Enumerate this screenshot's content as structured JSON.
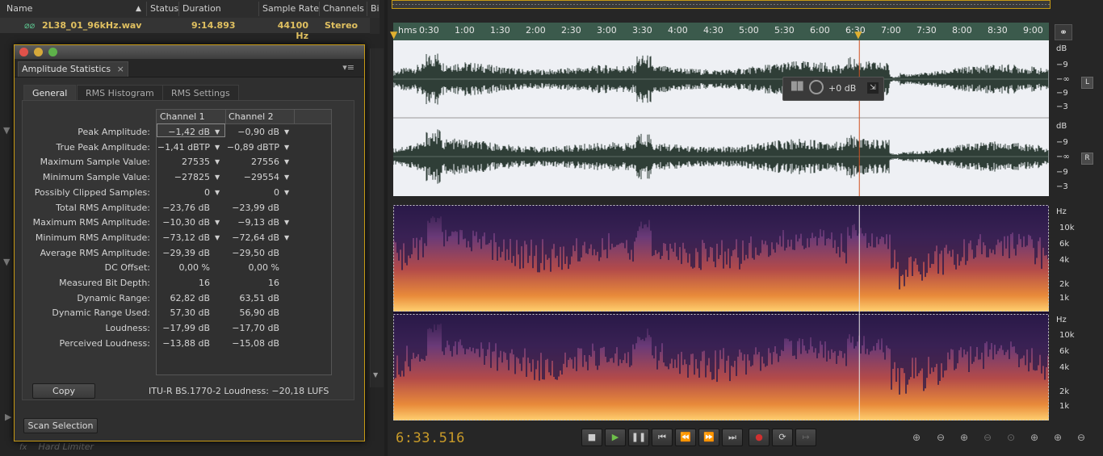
{
  "files": {
    "columns": [
      "Name",
      "Status",
      "Duration",
      "Sample Rate",
      "Channels",
      "Bi"
    ],
    "row": {
      "name": "2L38_01_96kHz.wav",
      "duration": "9:14.893",
      "sample_rate": "44100 Hz",
      "channels": "Stereo"
    },
    "ghost_text": "Hard Limiter"
  },
  "dialog": {
    "title": "Amplitude Statistics",
    "tabs": [
      "General",
      "RMS Histogram",
      "RMS Settings"
    ],
    "active_tab": "General",
    "columns": [
      "Channel 1",
      "Channel 2"
    ],
    "rows": [
      {
        "label": "Peak Amplitude:",
        "ch1": "−1,42 dB",
        "ch2": "−0,90 dB",
        "pin": true
      },
      {
        "label": "True Peak Amplitude:",
        "ch1": "−1,41 dBTP",
        "ch2": "−0,89 dBTP",
        "pin": true
      },
      {
        "label": "Maximum Sample Value:",
        "ch1": "27535",
        "ch2": "27556",
        "pin": true
      },
      {
        "label": "Minimum Sample Value:",
        "ch1": "−27825",
        "ch2": "−29554",
        "pin": true
      },
      {
        "label": "Possibly Clipped Samples:",
        "ch1": "0",
        "ch2": "0",
        "pin": true
      },
      {
        "label": "Total RMS Amplitude:",
        "ch1": "−23,76 dB",
        "ch2": "−23,99 dB",
        "pin": false
      },
      {
        "label": "Maximum RMS Amplitude:",
        "ch1": "−10,30 dB",
        "ch2": "−9,13 dB",
        "pin": true
      },
      {
        "label": "Minimum RMS Amplitude:",
        "ch1": "−73,12 dB",
        "ch2": "−72,64 dB",
        "pin": true
      },
      {
        "label": "Average RMS Amplitude:",
        "ch1": "−29,39 dB",
        "ch2": "−29,50 dB",
        "pin": false
      },
      {
        "label": "DC Offset:",
        "ch1": "0,00 %",
        "ch2": "0,00 %",
        "pin": false
      },
      {
        "label": "Measured Bit Depth:",
        "ch1": "16",
        "ch2": "16",
        "pin": false
      },
      {
        "label": "Dynamic Range:",
        "ch1": "62,82 dB",
        "ch2": "63,51 dB",
        "pin": false
      },
      {
        "label": "Dynamic Range Used:",
        "ch1": "57,30 dB",
        "ch2": "56,90 dB",
        "pin": false
      },
      {
        "label": "Loudness:",
        "ch1": "−17,99 dB",
        "ch2": "−17,70 dB",
        "pin": false
      },
      {
        "label": "Perceived Loudness:",
        "ch1": "−13,88 dB",
        "ch2": "−15,08 dB",
        "pin": false
      }
    ],
    "copy_label": "Copy",
    "loudness_text": "ITU-R BS.1770-2 Loudness: −20,18 LUFS",
    "scan_label": "Scan Selection"
  },
  "editor": {
    "time_ticks": [
      "hms",
      "0:30",
      "1:00",
      "1:30",
      "2:00",
      "2:30",
      "3:00",
      "3:30",
      "4:00",
      "4:30",
      "5:00",
      "5:30",
      "6:00",
      "6:30",
      "7:00",
      "7:30",
      "8:00",
      "8:30",
      "9:00"
    ],
    "db_labels": [
      "dB",
      "−9",
      "−∞",
      "−9",
      "−3"
    ],
    "channel_badges": [
      "L",
      "R"
    ],
    "hz_labels": [
      "Hz",
      "10k",
      "6k",
      "4k",
      "2k",
      "1k"
    ],
    "gain_value": "+0 dB",
    "current_time": "6:33.516",
    "playhead_fraction": 0.7109
  },
  "colors": {
    "accent": "#c99b29",
    "timeline": "#3b5a4c",
    "waveform": "#2f3e37",
    "playhead": "#d05020",
    "selection_border": "#c79a14"
  }
}
